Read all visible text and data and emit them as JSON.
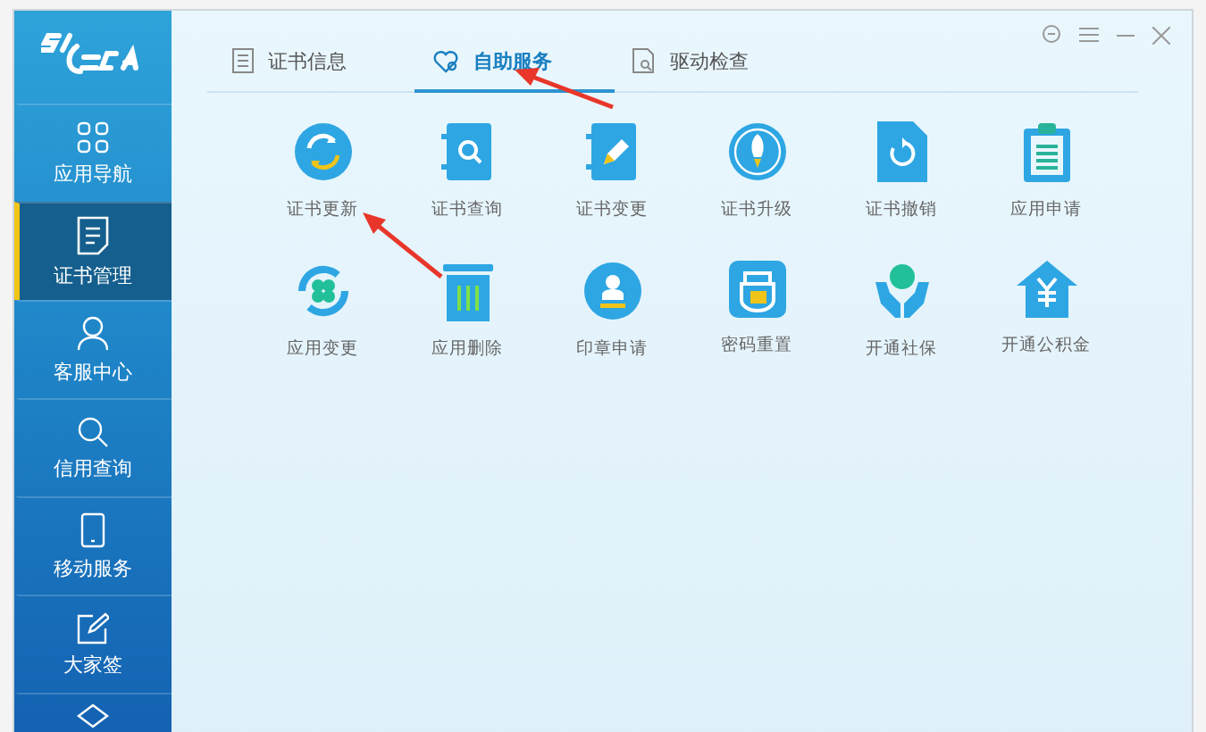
{
  "sidebar": {
    "items": [
      {
        "label": "应用导航",
        "selected": false
      },
      {
        "label": "证书管理",
        "selected": true
      },
      {
        "label": "客服中心",
        "selected": false
      },
      {
        "label": "信用查询",
        "selected": false
      },
      {
        "label": "移动服务",
        "selected": false
      },
      {
        "label": "大家签",
        "selected": false
      }
    ]
  },
  "tabs": [
    {
      "label": "证书信息",
      "selected": false
    },
    {
      "label": "自助服务",
      "selected": true
    },
    {
      "label": "驱动检查",
      "selected": false
    }
  ],
  "services": [
    {
      "label": "证书更新"
    },
    {
      "label": "证书查询"
    },
    {
      "label": "证书变更"
    },
    {
      "label": "证书升级"
    },
    {
      "label": "证书撤销"
    },
    {
      "label": "应用申请"
    },
    {
      "label": "应用变更"
    },
    {
      "label": "应用删除"
    },
    {
      "label": "印章申请"
    },
    {
      "label": "密码重置"
    },
    {
      "label": "开通社保"
    },
    {
      "label": "开通公积金"
    }
  ]
}
